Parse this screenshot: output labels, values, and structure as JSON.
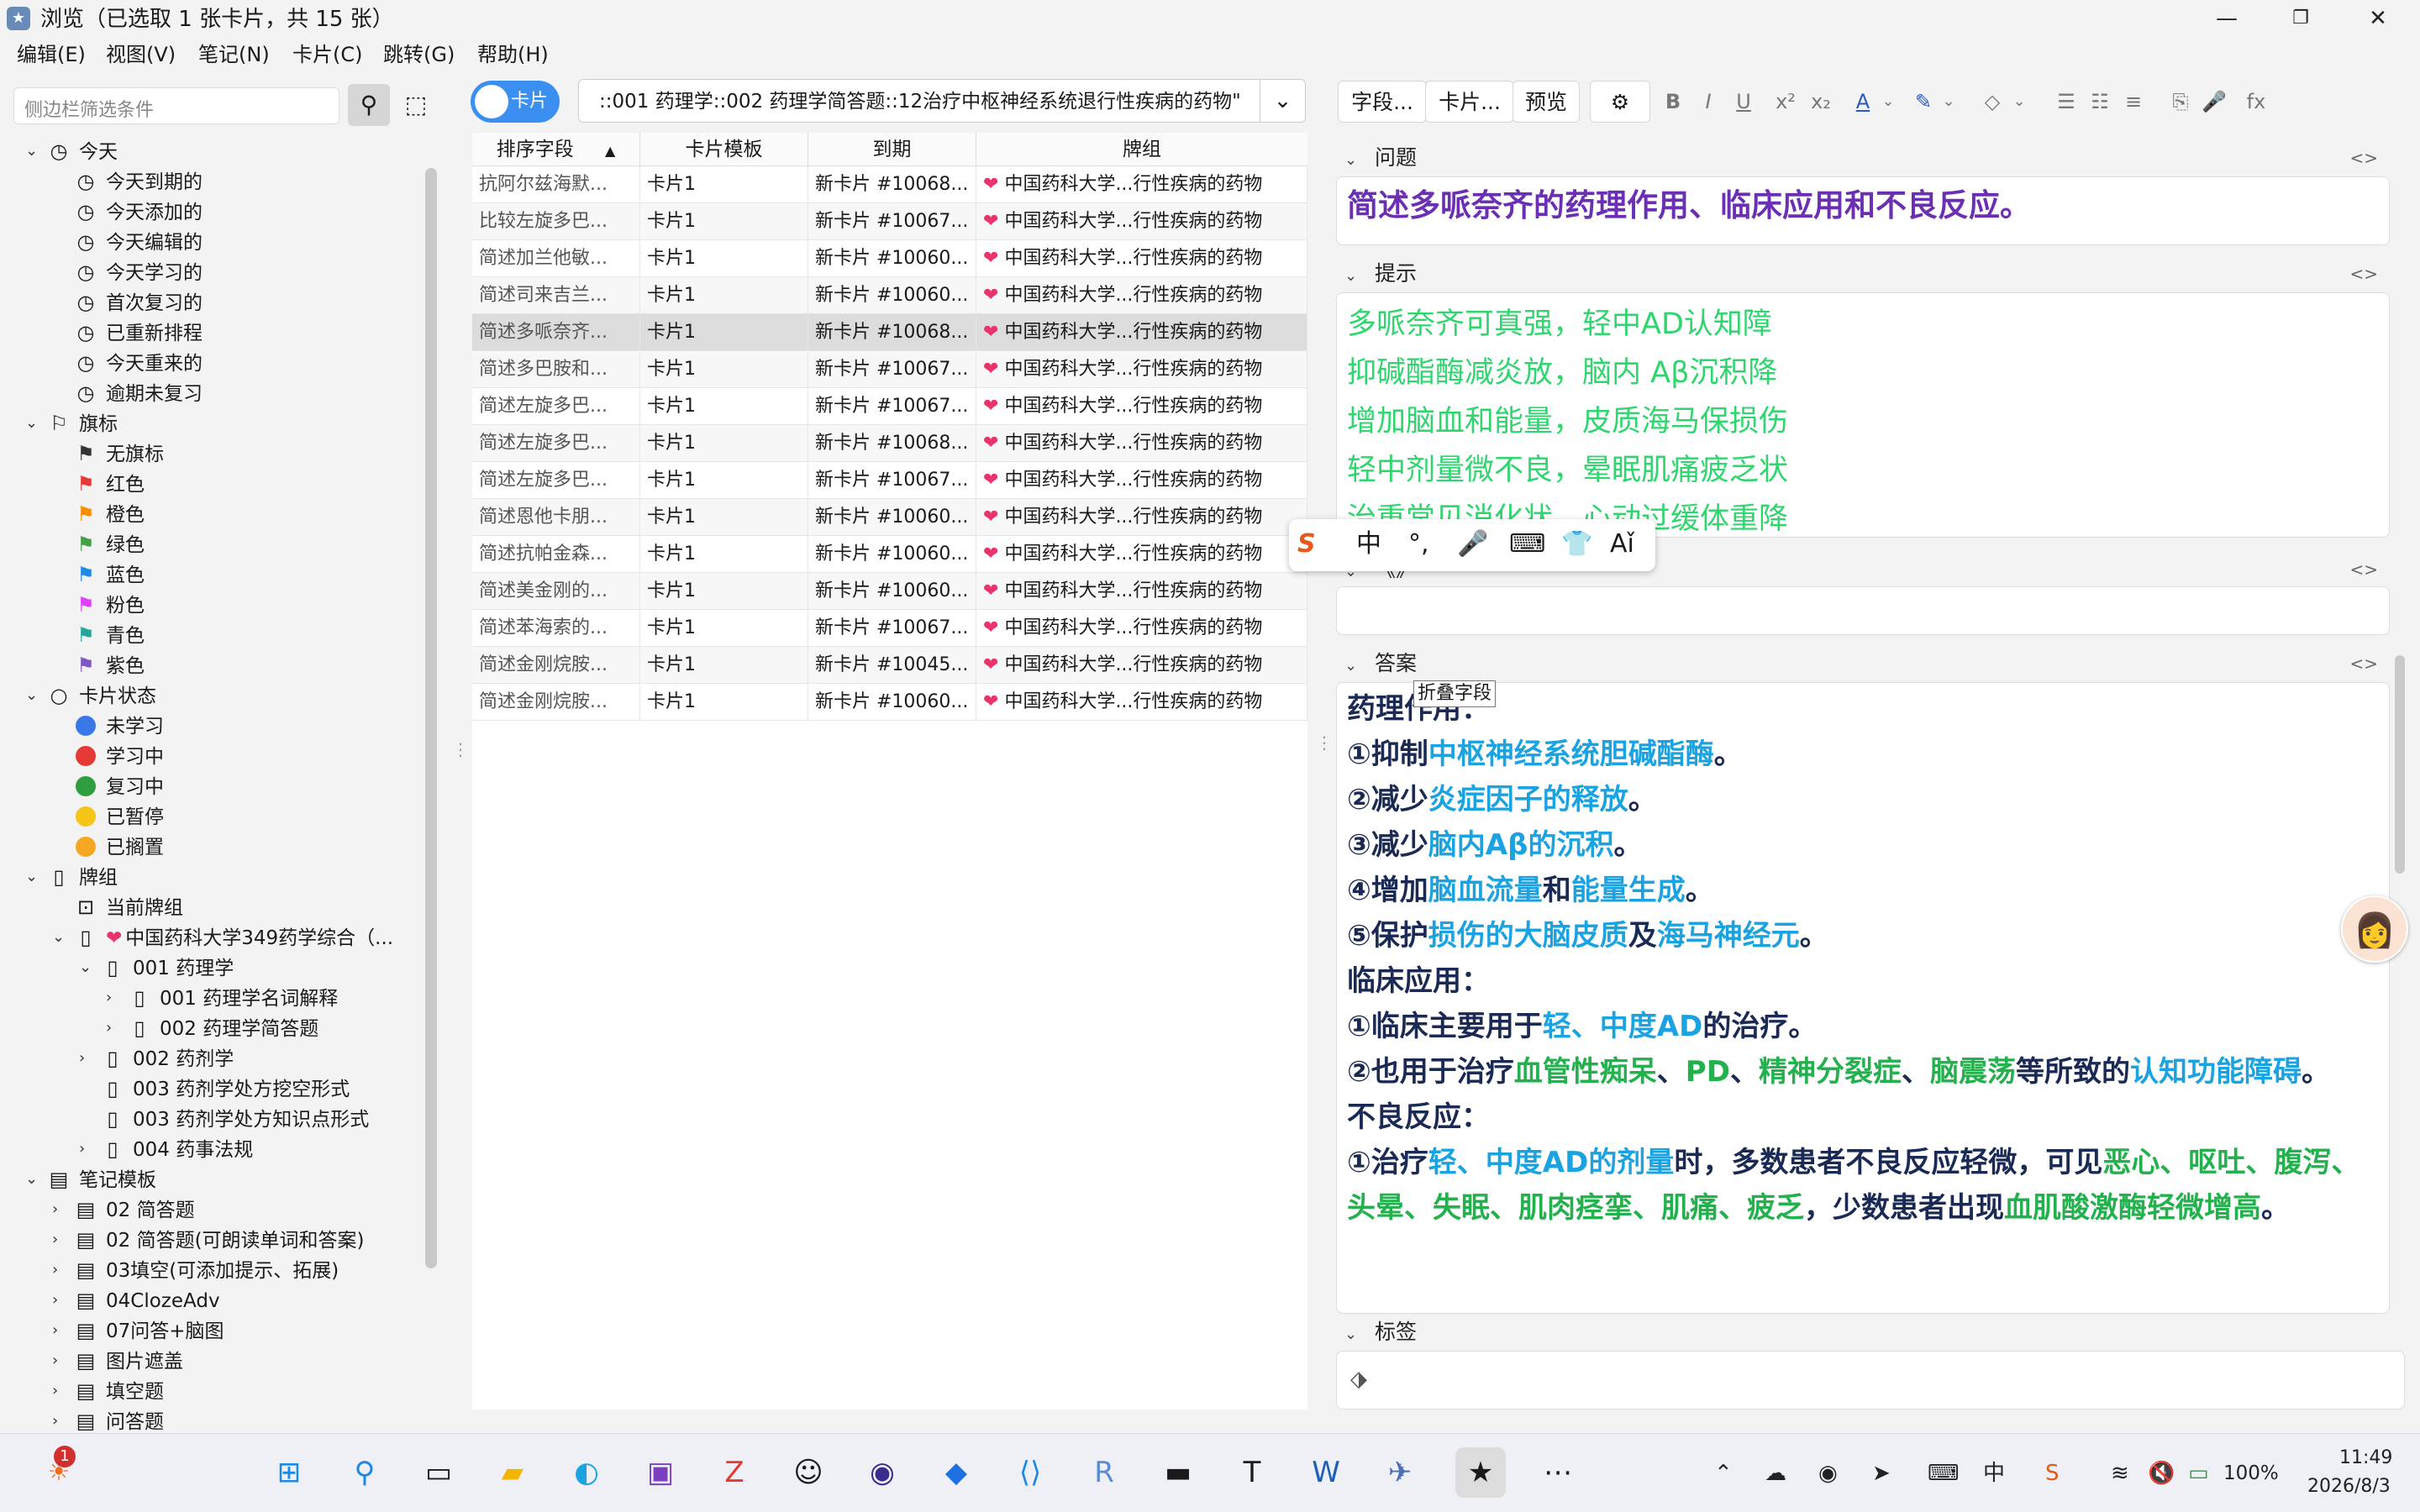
{
  "window": {
    "title": "浏览（已选取 1 张卡片，共 15 张）",
    "minimize": "—",
    "maximize": "❐",
    "close": "✕"
  },
  "menu": [
    "编辑(E)",
    "视图(V)",
    "笔记(N)",
    "卡片(C)",
    "跳转(G)",
    "帮助(H)"
  ],
  "sidebar": {
    "search_placeholder": "侧边栏筛选条件",
    "today": {
      "label": "今天",
      "items": [
        "今天到期的",
        "今天添加的",
        "今天编辑的",
        "今天学习的",
        "首次复习的",
        "已重新排程",
        "今天重来的",
        "逾期未复习"
      ]
    },
    "flags": {
      "label": "旗标",
      "items": [
        {
          "label": "无旗标",
          "color": "#333333"
        },
        {
          "label": "红色",
          "color": "#e53935"
        },
        {
          "label": "橙色",
          "color": "#fb8c00"
        },
        {
          "label": "绿色",
          "color": "#43a047"
        },
        {
          "label": "蓝色",
          "color": "#1e88e5"
        },
        {
          "label": "粉色",
          "color": "#e040fb"
        },
        {
          "label": "青色",
          "color": "#26a69a"
        },
        {
          "label": "紫色",
          "color": "#7e57c2"
        }
      ]
    },
    "card_state": {
      "label": "卡片状态",
      "items": [
        {
          "label": "未学习",
          "color": "#3b78e7"
        },
        {
          "label": "学习中",
          "color": "#e53935"
        },
        {
          "label": "复习中",
          "color": "#2e9e3e"
        },
        {
          "label": "已暂停",
          "color": "#f5c518"
        },
        {
          "label": "已搁置",
          "color": "#f5a623"
        }
      ]
    },
    "decks": {
      "label": "牌组",
      "current": "当前牌组",
      "root": "中国药科大学349药学综合（...",
      "items": [
        {
          "label": "001 药理学",
          "level": 2,
          "arrow": "▾"
        },
        {
          "label": "001 药理学名词解释",
          "level": 3,
          "arrow": "›"
        },
        {
          "label": "002 药理学简答题",
          "level": 3,
          "arrow": "›"
        },
        {
          "label": "002 药剂学",
          "level": 2,
          "arrow": "›"
        },
        {
          "label": "003 药剂学处方挖空形式",
          "level": 2,
          "arrow": ""
        },
        {
          "label": "003 药剂学处方知识点形式",
          "level": 2,
          "arrow": ""
        },
        {
          "label": "004 药事法规",
          "level": 2,
          "arrow": "›"
        }
      ]
    },
    "note_types": {
      "label": "笔记模板",
      "items": [
        "02 简答题",
        "02 简答题(可朗读单词和答案)",
        "03填空(可添加提示、拓展)",
        "04ClozeAdv",
        "07问答+脑图",
        "图片遮盖",
        "填空题",
        "问答题"
      ]
    }
  },
  "toolbar": {
    "toggle_label": "卡片",
    "search_text": "::001 药理学::002 药理学简答题::12治疗中枢神经系统退行性疾病的药物\""
  },
  "table": {
    "headers": [
      "排序字段",
      "卡片模板",
      "到期",
      "牌组"
    ],
    "sort_arrow": "▲",
    "rows": [
      [
        "抗阿尔兹海默...",
        "卡片1",
        "新卡片 #10068...",
        "中国药科大学...行性疾病的药物"
      ],
      [
        "比较左旋多巴...",
        "卡片1",
        "新卡片 #10067...",
        "中国药科大学...行性疾病的药物"
      ],
      [
        "简述加兰他敏...",
        "卡片1",
        "新卡片 #10060...",
        "中国药科大学...行性疾病的药物"
      ],
      [
        "简述司来吉兰...",
        "卡片1",
        "新卡片 #10060...",
        "中国药科大学...行性疾病的药物"
      ],
      [
        "简述多哌奈齐...",
        "卡片1",
        "新卡片 #10068...",
        "中国药科大学...行性疾病的药物"
      ],
      [
        "简述多巴胺和...",
        "卡片1",
        "新卡片 #10067...",
        "中国药科大学...行性疾病的药物"
      ],
      [
        "简述左旋多巴...",
        "卡片1",
        "新卡片 #10067...",
        "中国药科大学...行性疾病的药物"
      ],
      [
        "简述左旋多巴...",
        "卡片1",
        "新卡片 #10068...",
        "中国药科大学...行性疾病的药物"
      ],
      [
        "简述左旋多巴...",
        "卡片1",
        "新卡片 #10067...",
        "中国药科大学...行性疾病的药物"
      ],
      [
        "简述恩他卡朋...",
        "卡片1",
        "新卡片 #10060...",
        "中国药科大学...行性疾病的药物"
      ],
      [
        "简述抗帕金森...",
        "卡片1",
        "新卡片 #10060...",
        "中国药科大学...行性疾病的药物"
      ],
      [
        "简述美金刚的...",
        "卡片1",
        "新卡片 #10060...",
        "中国药科大学...行性疾病的药物"
      ],
      [
        "简述苯海索的...",
        "卡片1",
        "新卡片 #10067...",
        "中国药科大学...行性疾病的药物"
      ],
      [
        "简述金刚烷胺...",
        "卡片1",
        "新卡片 #10045...",
        "中国药科大学...行性疾病的药物"
      ],
      [
        "简述金刚烷胺...",
        "卡片1",
        "新卡片 #10060...",
        "中国药科大学...行性疾病的药物"
      ]
    ],
    "selected_index": 4
  },
  "editor": {
    "buttons": [
      "字段...",
      "卡片...",
      "预览"
    ],
    "format_icons": [
      "B",
      "I",
      "U",
      "x²",
      "x₂",
      "A",
      "⌄",
      "✎",
      "⌄",
      "◇",
      "⌄",
      "☰",
      "☷",
      "≡",
      "⎘",
      "🎤",
      "fx"
    ],
    "fields": {
      "question_label": "问题",
      "question": "简述多哌奈齐的药理作用、临床应用和不良反应。",
      "hint_label": "提示",
      "hint_lines": [
        "多哌奈齐可真强，轻中AD认知障",
        "抑碱酯酶减炎放，脑内 Aβ沉积降",
        "增加脑血和能量，皮质海马保损伤",
        "轻中剂量微不良，晕眠肌痛疲乏状",
        "治重常见消化状，心动过缓体重降"
      ],
      "collapsed_hint": "《》",
      "answer_label": "答案",
      "tags_label": "标签",
      "tooltip": "折叠字段",
      "toggle": "<>"
    },
    "answer": [
      [
        {
          "t": "药理作用：",
          "c": ""
        }
      ],
      [
        {
          "t": "①抑制",
          "c": ""
        },
        {
          "t": "中枢神经系统胆碱酯酶",
          "c": "blue"
        },
        {
          "t": "。",
          "c": ""
        }
      ],
      [
        {
          "t": "②减少",
          "c": ""
        },
        {
          "t": "炎症因子的释放",
          "c": "blue"
        },
        {
          "t": "。",
          "c": ""
        }
      ],
      [
        {
          "t": "③减少",
          "c": ""
        },
        {
          "t": "脑内Aβ的沉积",
          "c": "blue"
        },
        {
          "t": "。",
          "c": ""
        }
      ],
      [
        {
          "t": "④增加",
          "c": ""
        },
        {
          "t": "脑血流量",
          "c": "blue"
        },
        {
          "t": "和",
          "c": ""
        },
        {
          "t": "能量生成",
          "c": "blue"
        },
        {
          "t": "。",
          "c": ""
        }
      ],
      [
        {
          "t": "⑤保护",
          "c": ""
        },
        {
          "t": "损伤的大脑皮质",
          "c": "blue"
        },
        {
          "t": "及",
          "c": ""
        },
        {
          "t": "海马神经元",
          "c": "blue"
        },
        {
          "t": "。",
          "c": ""
        }
      ],
      [
        {
          "t": "临床应用：",
          "c": ""
        }
      ],
      [
        {
          "t": "①临床主要用于",
          "c": ""
        },
        {
          "t": "轻、中度AD",
          "c": "blue"
        },
        {
          "t": "的治疗。",
          "c": ""
        }
      ],
      [
        {
          "t": "②也用于治疗",
          "c": ""
        },
        {
          "t": "血管性痴呆",
          "c": "green"
        },
        {
          "t": "、",
          "c": ""
        },
        {
          "t": "PD",
          "c": "green"
        },
        {
          "t": "、",
          "c": ""
        },
        {
          "t": "精神分裂症",
          "c": "green"
        },
        {
          "t": "、",
          "c": ""
        },
        {
          "t": "脑震荡",
          "c": "green"
        },
        {
          "t": "等所致的",
          "c": ""
        },
        {
          "t": "认知功能障碍",
          "c": "blue"
        },
        {
          "t": "。",
          "c": ""
        }
      ],
      [
        {
          "t": "不良反应：",
          "c": ""
        }
      ],
      [
        {
          "t": "①治疗",
          "c": ""
        },
        {
          "t": "轻、中度AD的剂量",
          "c": "blue"
        },
        {
          "t": "时，多数患者不良反应轻微，可见",
          "c": ""
        },
        {
          "t": "恶心、呕吐、腹泻、头晕、失眠、肌肉痉挛、肌痛、疲乏",
          "c": "green"
        },
        {
          "t": "，少数患者出现",
          "c": ""
        },
        {
          "t": "血肌酸激酶轻微增高",
          "c": "green"
        },
        {
          "t": "。",
          "c": ""
        }
      ]
    ],
    "colors": {
      "question": "#6b2fb3",
      "hint": "#2fd66e",
      "blue": "#1aa3e0",
      "green": "#22b14c"
    }
  },
  "ime": {
    "items": [
      "S",
      "中",
      "°,",
      "🎤",
      "⌨",
      "👕",
      "Aǐ"
    ]
  },
  "taskbar": {
    "notification_badge": "1",
    "tray": {
      "battery": "100%",
      "time": "11:49",
      "date": "2026/8/3"
    }
  }
}
